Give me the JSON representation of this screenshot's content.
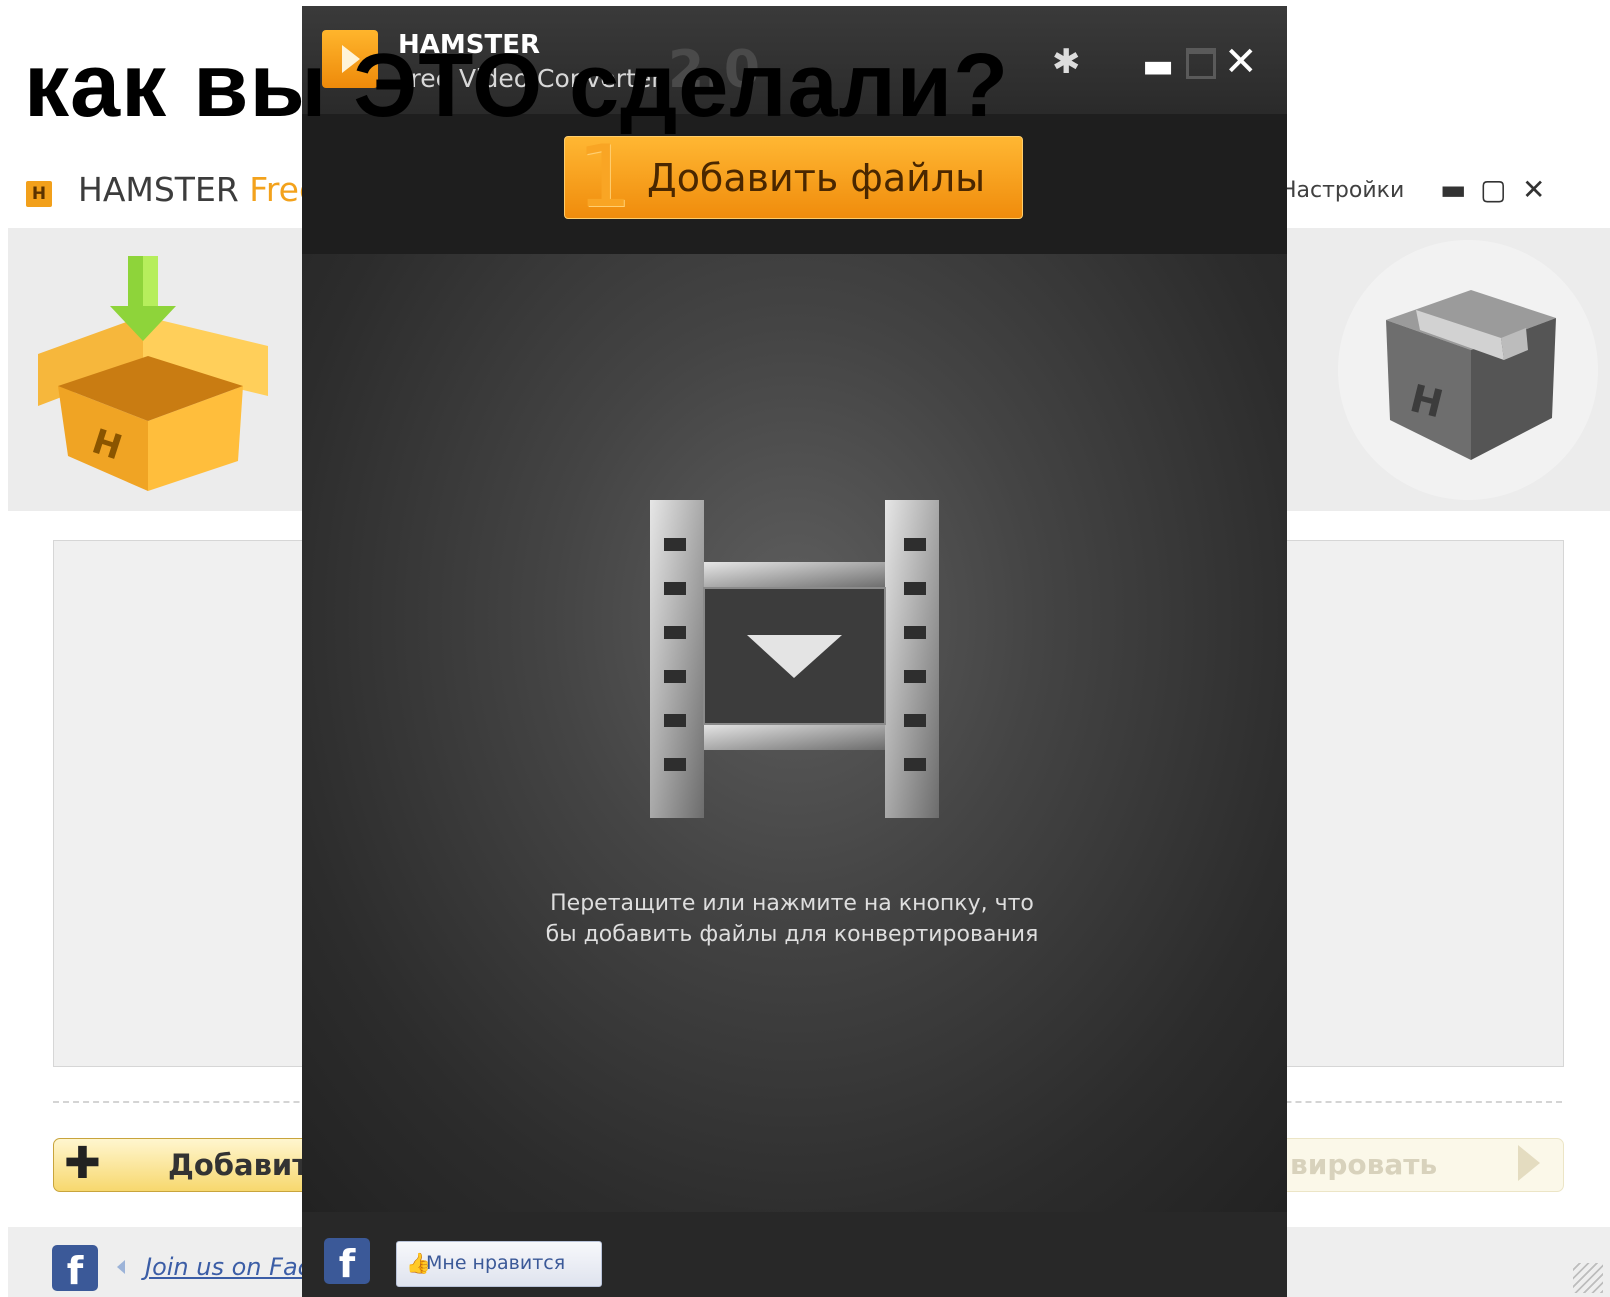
{
  "headline": "как вы ЭТО сделали?",
  "background_app": {
    "logo_letter": "H",
    "title": "HAMSTER",
    "title_free": "Free",
    "settings_label": "Настройки",
    "minimize_glyph": "▬",
    "maximize_glyph": "▢",
    "close_glyph": "✕",
    "add_button_label": "Добавит",
    "convert_button_label": "вировать",
    "facebook_letter": "f",
    "join_link": "Join us on Fac",
    "icons": [
      "open-box-icon",
      "closed-box-icon",
      "plus-icon",
      "arrow-right-icon",
      "facebook-icon",
      "resize-grip-icon"
    ]
  },
  "foreground_app": {
    "app_name": "HAMSTER",
    "app_subtitle": "Free Video Converter",
    "version": "2.0",
    "gear_glyph": "✱",
    "minimize_glyph": "▬",
    "close_glyph": "✕",
    "add_step_number": "1",
    "add_files_label": "Добавить файлы",
    "drop_hint": "Перетащите или нажмите на кнопку, что бы добавить файлы для конвертирования",
    "facebook_letter": "f",
    "like_icon": "👍",
    "like_label": "Мне нравится",
    "icons": [
      "play-logo-icon",
      "gear-icon",
      "minimize-icon",
      "maximize-icon",
      "close-icon",
      "film-strip-icon",
      "facebook-icon",
      "thumbs-up-icon"
    ]
  },
  "colors": {
    "accent_orange": "#f39a18",
    "dark_window": "#2e2e2e",
    "facebook_blue": "#3b5998"
  }
}
